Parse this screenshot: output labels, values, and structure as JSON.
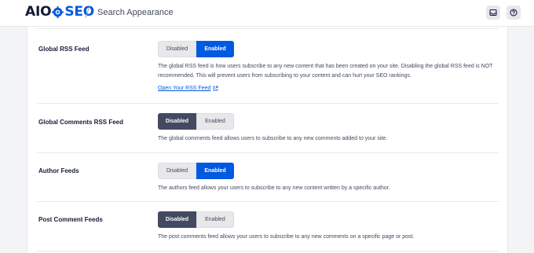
{
  "header": {
    "logo": {
      "prefix": "AIO",
      "suffix": "SEO"
    },
    "page_title": "Search Appearance",
    "accent_color": "#005ae0"
  },
  "settings": [
    {
      "label": "Global RSS Feed",
      "options": [
        "Disabled",
        "Enabled"
      ],
      "selected": "Enabled",
      "description_lines": [
        "The global RSS feed is how users subscribe to any new content that has been created on your site. Disabling the global RSS feed is NOT",
        "recommended. This will prevent users from subscribing to your content and can hurt your SEO rankings."
      ],
      "link": "Open Your RSS Feed"
    },
    {
      "label": "Global Comments RSS Feed",
      "options": [
        "Disabled",
        "Enabled"
      ],
      "selected": "Disabled",
      "description_lines": [
        "The global comments feed allows users to subscribe to any new comments added to your site."
      ]
    },
    {
      "label": "Author Feeds",
      "options": [
        "Disabled",
        "Enabled"
      ],
      "selected": "Enabled",
      "description_lines": [
        "The authors feed allows your users to subscribe to any new content written by a specific author."
      ]
    },
    {
      "label": "Post Comment Feeds",
      "options": [
        "Disabled",
        "Enabled"
      ],
      "selected": "Disabled",
      "description_lines": [
        "The post comments feed allows your users to subscribe to any new comments on a specific page or post."
      ]
    }
  ]
}
